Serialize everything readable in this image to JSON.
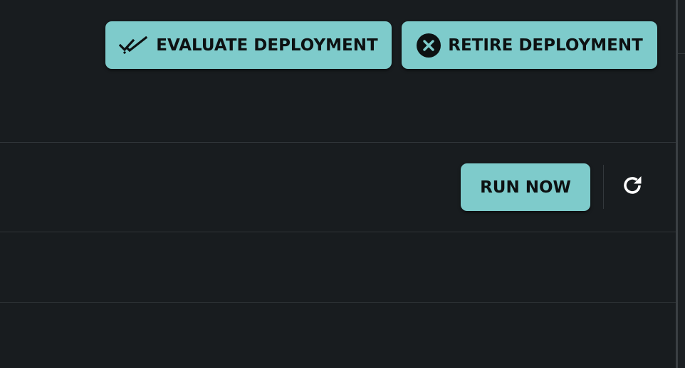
{
  "toolbar": {
    "evaluate_label": "EVALUATE DEPLOYMENT",
    "evaluate_icon": "double-check-icon",
    "retire_label": "RETIRE DEPLOYMENT",
    "retire_icon": "close-circle-icon"
  },
  "schedule_row": {
    "run_now_label": "RUN NOW",
    "refresh_icon": "refresh-icon"
  },
  "colors": {
    "background": "#181c1f",
    "button_accent": "#7ecbcb",
    "button_text": "#0d1112",
    "divider": "#2f3438"
  }
}
